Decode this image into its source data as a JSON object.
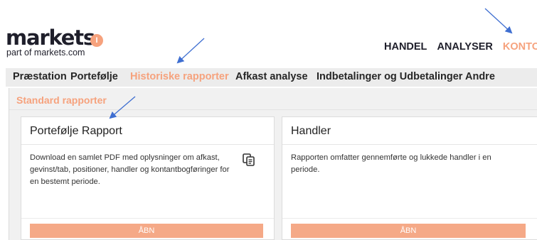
{
  "logo": {
    "word": "markets",
    "badge": "I",
    "sub": "part of markets.com"
  },
  "top_nav": {
    "items": [
      "HANDEL",
      "ANALYSER",
      "KONTO"
    ]
  },
  "sub_nav": {
    "items": [
      "Præstation",
      "Portefølje",
      "Historiske rapporter",
      "Afkast analyse",
      "Indbetalinger og Udbetalinger",
      "Andre"
    ]
  },
  "section": {
    "title": "Standard rapporter"
  },
  "cards": [
    {
      "title": "Portefølje Rapport",
      "description": "Download en samlet PDF med oplysninger om afkast,\ngevinst/tab, positioner, handler og kontantbogføringer for\nen bestemt periode.",
      "button": "ÅBN"
    },
    {
      "title": "Handler",
      "description": "Rapporten omfatter gennemførte og lukkede handler i en\nperiode.",
      "button": "ÅBN"
    }
  ],
  "colors": {
    "accent": "#f6a27d",
    "arrow": "#3f6fd1",
    "nav_bg": "#ececec",
    "panel_bg": "#f1f1f1"
  },
  "icons": {
    "copy": "copy-docs-icon"
  }
}
